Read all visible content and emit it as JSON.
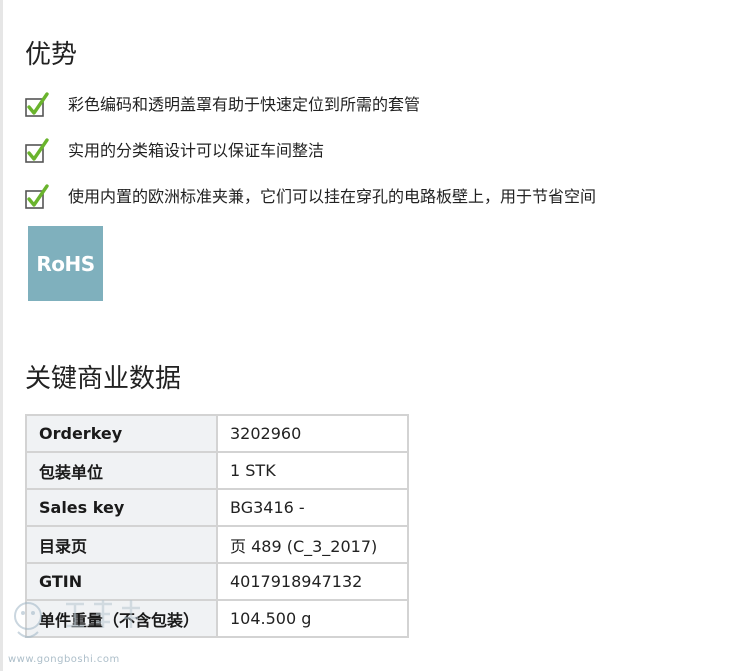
{
  "advantages": {
    "title": "优势",
    "items": [
      "彩色编码和透明盖罩有助于快速定位到所需的套管",
      "实用的分类箱设计可以保证车间整洁",
      "使用内置的欧洲标准夹兼，它们可以挂在穿孔的电路板壁上，用于节省空间"
    ],
    "badge_text": "RoHS",
    "check_color": "#6ab42d"
  },
  "key_data": {
    "title": "关键商业数据",
    "rows": [
      {
        "label": "Orderkey",
        "value": "3202960"
      },
      {
        "label": "包装单位",
        "value": "1 STK"
      },
      {
        "label": "Sales key",
        "value": "BG3416 -"
      },
      {
        "label": "目录页",
        "value": "页 489 (C_3_2017)"
      },
      {
        "label": "GTIN",
        "value": "4017918947132"
      },
      {
        "label": "单件重量（不含包装）",
        "value": "104.500 g"
      }
    ]
  },
  "watermark": {
    "url_text": "www.gongboshi.com"
  }
}
